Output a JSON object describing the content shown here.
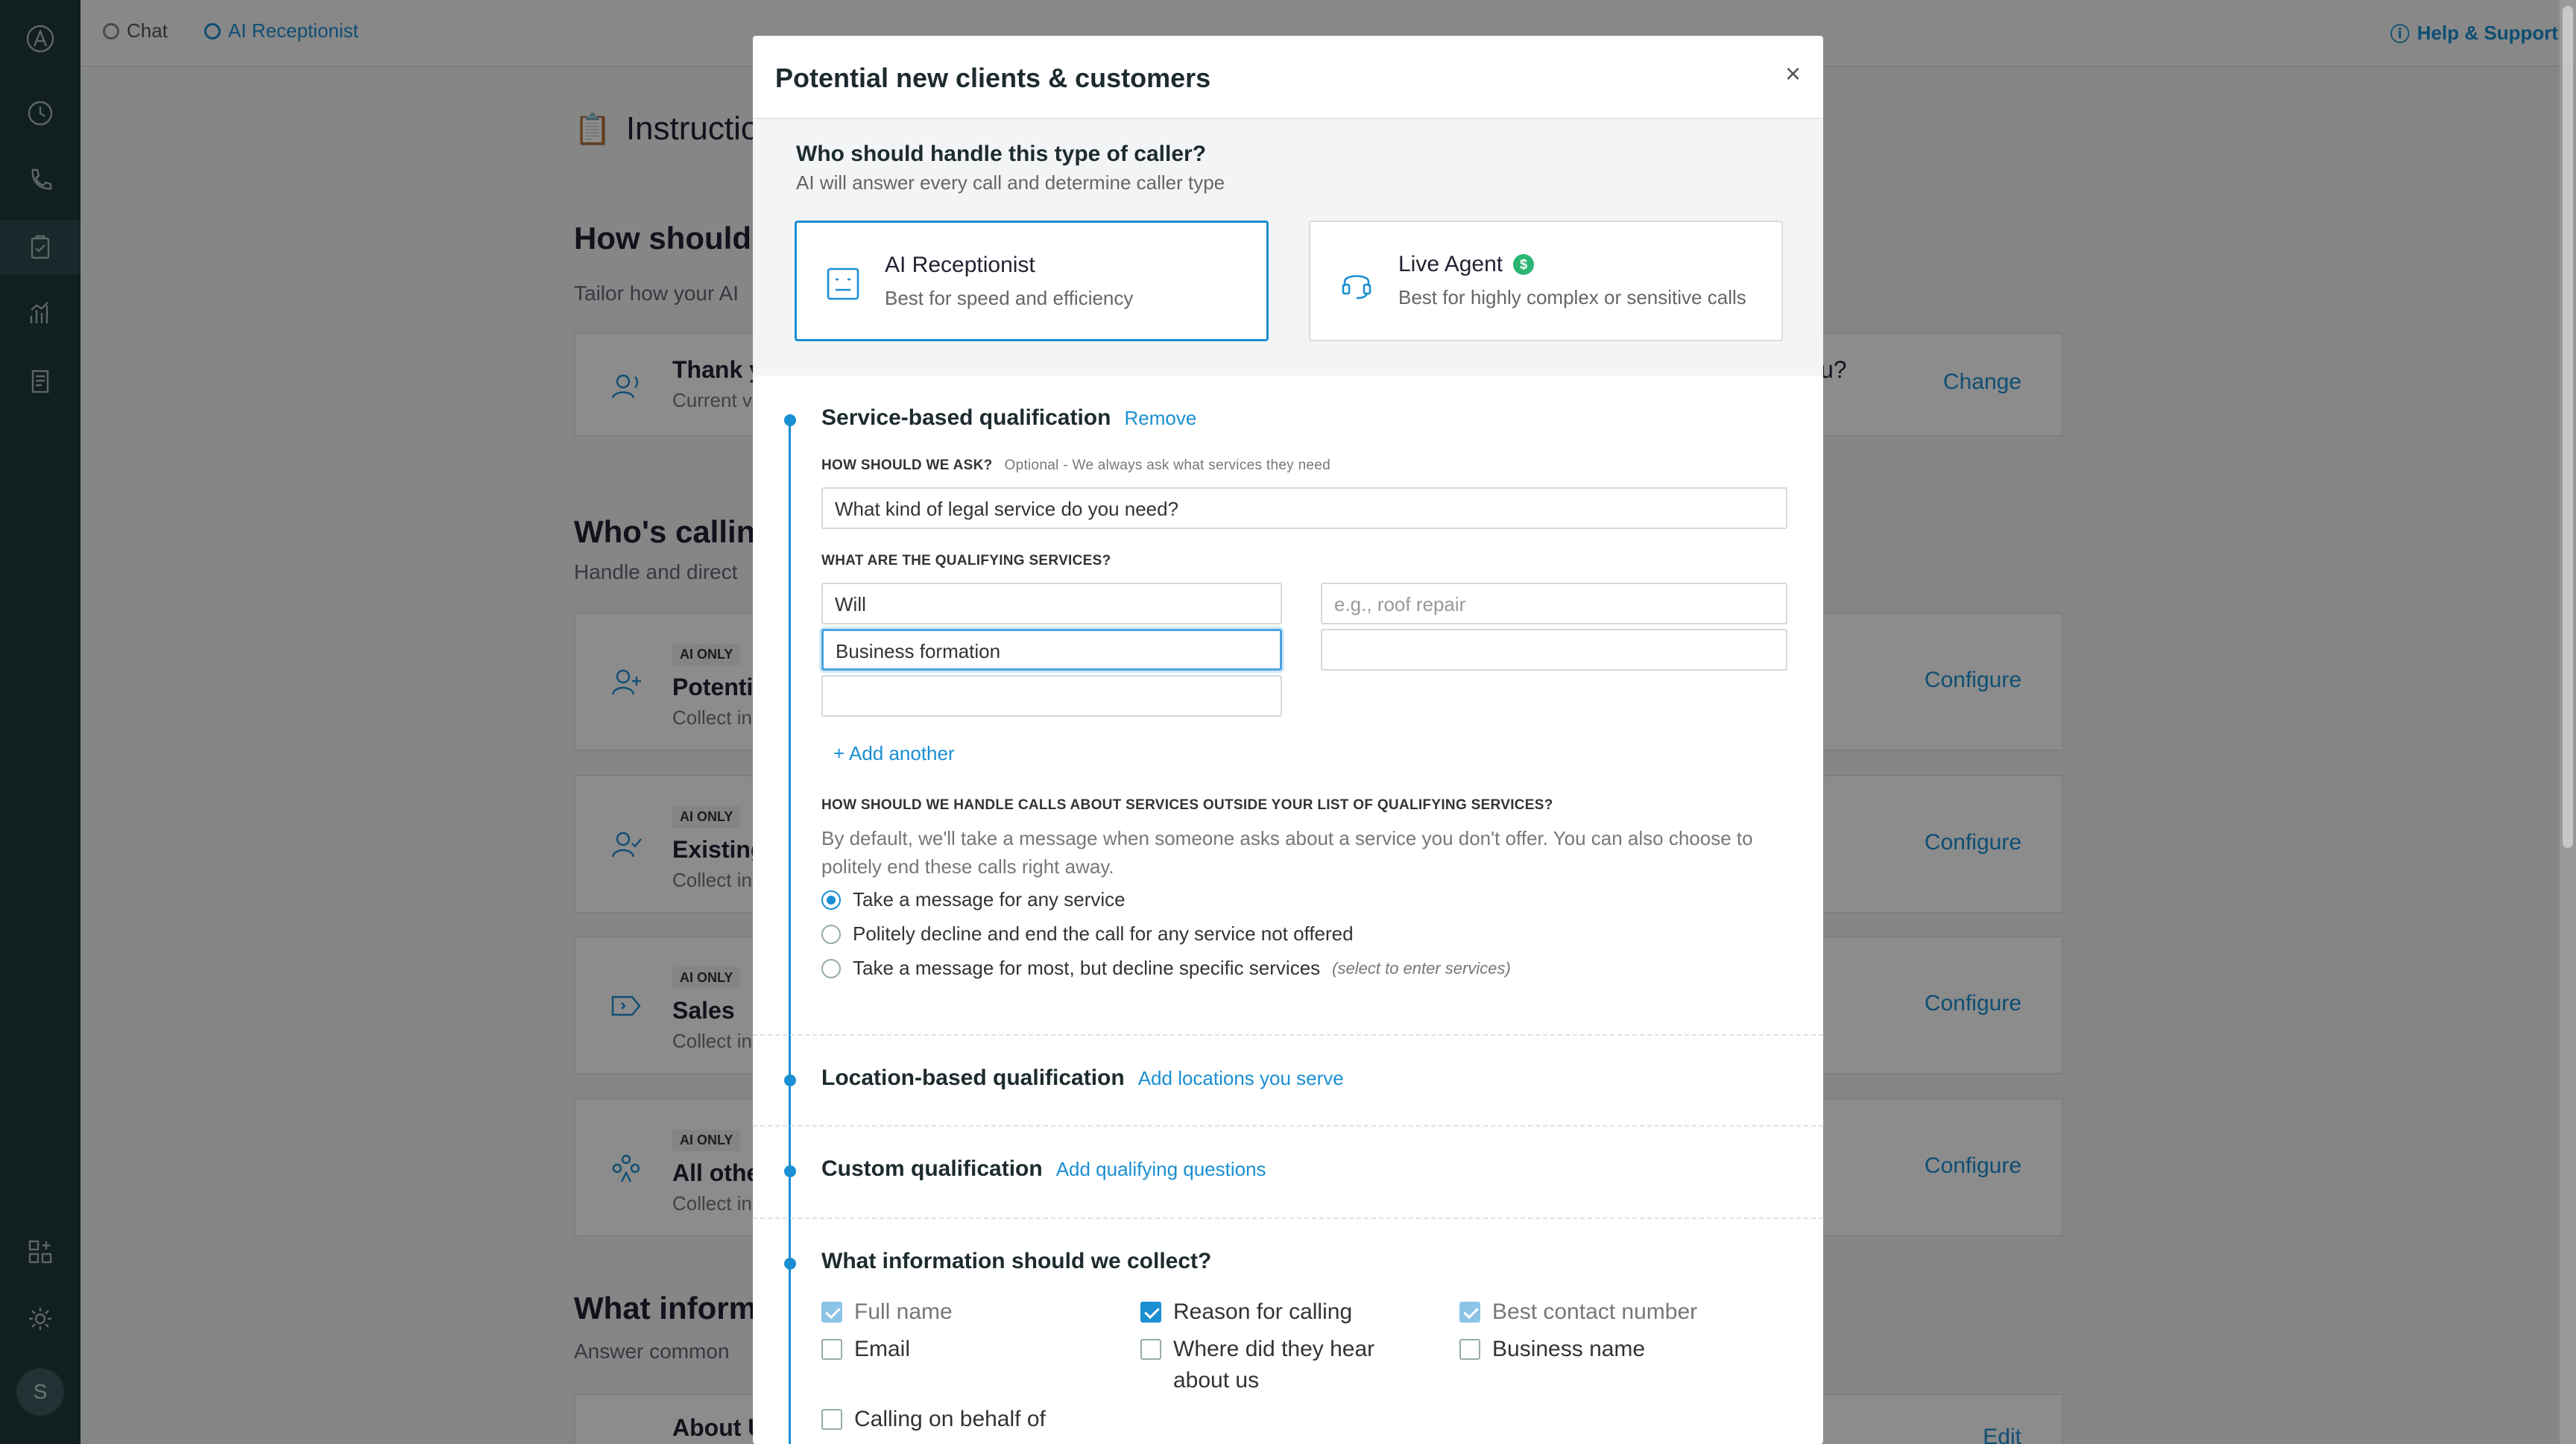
{
  "topbar": {
    "crumb_chat": "Chat",
    "crumb_ai": "AI Receptionist",
    "help": "Help & Support"
  },
  "rail": {
    "avatar_letter": "S"
  },
  "background": {
    "title": "Instructio",
    "how_heading": "How should y",
    "how_sub": "Tailor how your AI",
    "greeting_title": "Thank y",
    "greeting_sub": "Current v",
    "greeting_suffix": "u?",
    "greeting_change": "Change",
    "who_heading": "Who's calling",
    "who_sub": "Handle and direct",
    "cards": [
      {
        "badge": "AI ONLY",
        "title": "Potentia",
        "sub": "Collect in",
        "action": "Configure"
      },
      {
        "badge": "AI ONLY",
        "title": "Existing",
        "sub": "Collect in",
        "action": "Configure"
      },
      {
        "badge": "AI ONLY",
        "title": "Sales",
        "sub": "Collect in",
        "action": "Configure"
      },
      {
        "badge": "AI ONLY",
        "title": "All othe",
        "sub": "Collect in",
        "action": "Configure"
      }
    ],
    "info_heading": "What inform",
    "info_sub": "Answer common",
    "about_title": "About U",
    "about_edit": "Edit"
  },
  "modal": {
    "title": "Potential new clients & customers",
    "close": "×",
    "who_question": "Who should handle this type of caller?",
    "who_sub": "AI will answer every call and determine caller type",
    "options": [
      {
        "title": "AI Receptionist",
        "sub": "Best for speed and efficiency",
        "selected": true
      },
      {
        "title": "Live Agent",
        "sub": "Best for highly complex or sensitive calls",
        "badge": "$",
        "selected": false
      }
    ],
    "service": {
      "title": "Service-based qualification",
      "remove": "Remove",
      "ask_label": "HOW SHOULD WE ASK?",
      "ask_note": "Optional - We always ask what services they need",
      "ask_value": "What kind of legal service do you need?",
      "services_label": "WHAT ARE THE QUALIFYING SERVICES?",
      "services": [
        "Will",
        "e.g., roof repair",
        "Business formation",
        "",
        ""
      ],
      "add_another": "+ Add another",
      "outside_label": "HOW SHOULD WE HANDLE CALLS ABOUT SERVICES OUTSIDE YOUR LIST OF QUALIFYING SERVICES?",
      "outside_desc": "By default, we'll take a message when someone asks about a service you don't offer. You can also choose to politely end these calls right away.",
      "radios": [
        {
          "label": "Take a message for any service",
          "checked": true
        },
        {
          "label": "Politely decline and end the call for any service not offered",
          "checked": false
        },
        {
          "label": "Take a message for most, but decline specific services",
          "hint": "(select to enter services)",
          "checked": false
        }
      ]
    },
    "location": {
      "title": "Location-based qualification",
      "link": "Add locations you serve"
    },
    "custom": {
      "title": "Custom qualification",
      "link": "Add qualifying questions"
    },
    "collect": {
      "title": "What information should we collect?",
      "items": [
        {
          "label": "Full name",
          "state": "locked"
        },
        {
          "label": "Reason for calling",
          "state": "checked"
        },
        {
          "label": "Best contact number",
          "state": "locked"
        },
        {
          "label": "Email",
          "state": "unchecked"
        },
        {
          "label": "Where did they hear about us",
          "state": "unchecked"
        },
        {
          "label": "Business name",
          "state": "unchecked"
        },
        {
          "label": "Calling on behalf of",
          "state": "unchecked"
        }
      ]
    }
  }
}
